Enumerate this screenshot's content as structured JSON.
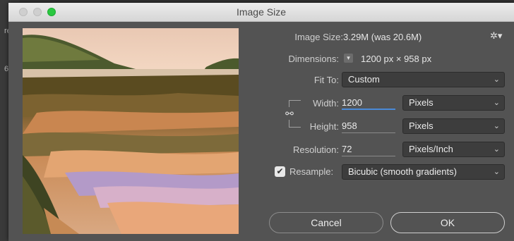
{
  "dialog": {
    "title": "Image Size"
  },
  "background_fragments": [
    "re",
    "6"
  ],
  "info": {
    "image_size_label": "Image Size:",
    "image_size_value": "3.29M (was 20.6M)",
    "dimensions_label": "Dimensions:",
    "dimensions_value": "1200 px  ×  958 px"
  },
  "fit_to": {
    "label": "Fit To:",
    "value": "Custom"
  },
  "width": {
    "label": "Width:",
    "value": "1200",
    "unit": "Pixels"
  },
  "height": {
    "label": "Height:",
    "value": "958",
    "unit": "Pixels"
  },
  "resolution": {
    "label": "Resolution:",
    "value": "72",
    "unit": "Pixels/Inch"
  },
  "resample": {
    "label": "Resample:",
    "checked": true,
    "value": "Bicubic (smooth gradients)"
  },
  "buttons": {
    "cancel": "Cancel",
    "ok": "OK"
  },
  "icons": {
    "gear": "gear-icon",
    "chevron": "chevron-down-icon",
    "chain": "link-chain-icon",
    "check": "checkmark-icon"
  },
  "colors": {
    "focus_accent": "#4a8ad8",
    "maximize": "#2ac840"
  }
}
